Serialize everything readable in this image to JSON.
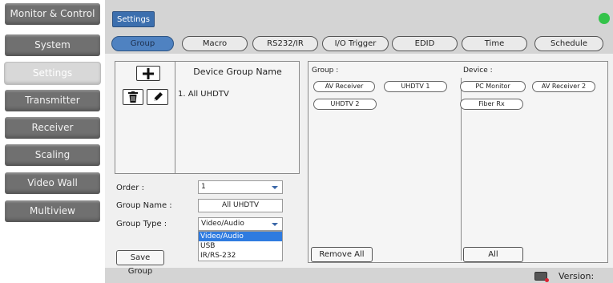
{
  "sidebar": {
    "items": [
      {
        "label": "Monitor & Control"
      },
      {
        "label": "System"
      },
      {
        "label": "Settings"
      },
      {
        "label": "Transmitter"
      },
      {
        "label": "Receiver"
      },
      {
        "label": "Scaling"
      },
      {
        "label": "Video Wall"
      },
      {
        "label": "Multiview"
      }
    ],
    "active": "Settings"
  },
  "header": {
    "page_title": "Settings",
    "status_color": "#34c34a"
  },
  "tabs": [
    {
      "label": "Group"
    },
    {
      "label": "Macro"
    },
    {
      "label": "RS232/IR"
    },
    {
      "label": "I/O Trigger"
    },
    {
      "label": "EDID"
    },
    {
      "label": "Time"
    },
    {
      "label": "Schedule"
    }
  ],
  "group_list": {
    "header": "Device Group Name",
    "items": [
      "1. All UHDTV"
    ],
    "add_icon": "plus-icon",
    "delete_icon": "trash-icon",
    "edit_icon": "pencil-icon"
  },
  "form": {
    "order_label": "Order :",
    "order_value": "1",
    "group_name_label": "Group Name :",
    "group_name_value": "All UHDTV",
    "group_type_label": "Group Type :",
    "group_type_value": "Video/Audio",
    "group_type_options": [
      "Video/Audio",
      "USB",
      "IR/RS-232"
    ],
    "save_label": "Save Group"
  },
  "group_panel": {
    "title": "Group :",
    "chips": [
      "AV Receiver",
      "UHDTV 1",
      "UHDTV 2"
    ],
    "remove_all_label": "Remove All"
  },
  "device_panel": {
    "title": "Device :",
    "chips": [
      "PC Monitor",
      "AV Receiver 2",
      "Fiber Rx"
    ],
    "all_label": "All"
  },
  "footer": {
    "version_label": "Version:",
    "icon": "keyboard-icon"
  }
}
